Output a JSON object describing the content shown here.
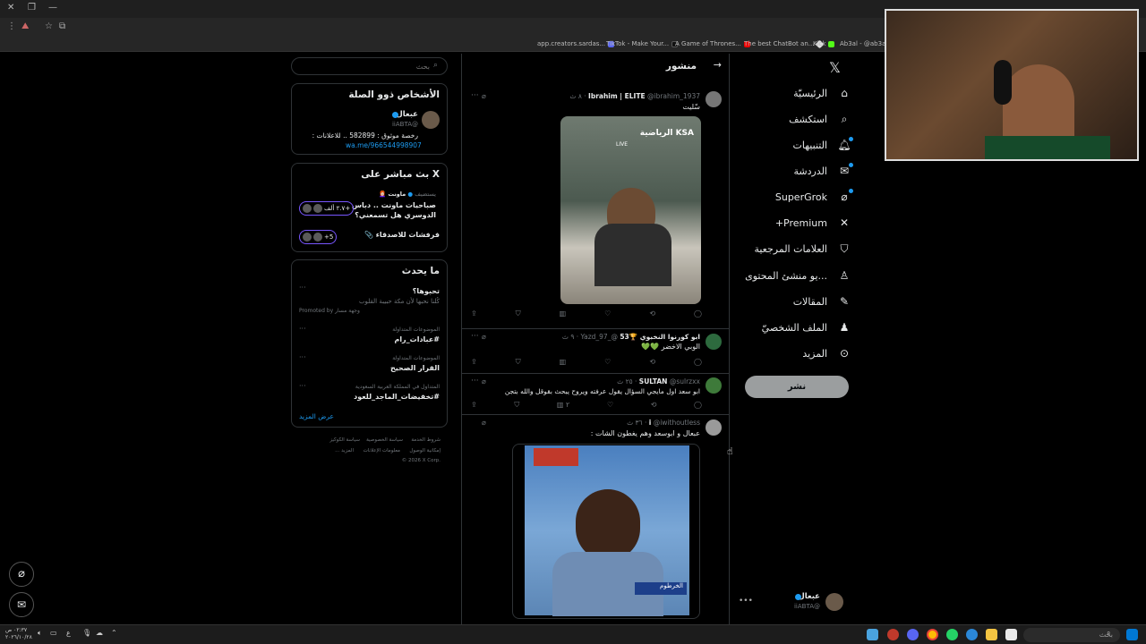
{
  "bookmarks": [
    "app.creators.sardas...",
    "TikTok - Make Your...",
    "A Game of Thrones...",
    "The best ChatBot an...",
    "Kick",
    "Ab3al - @ab3al |"
  ],
  "search": {
    "placeholder": "بحث"
  },
  "nav": {
    "items": [
      {
        "label": "الرئيسيّة",
        "icon": "home-icon"
      },
      {
        "label": "استكشف",
        "icon": "search-icon"
      },
      {
        "label": "التنبيهات",
        "icon": "bell-icon"
      },
      {
        "label": "الدردشة",
        "icon": "mail-icon"
      },
      {
        "label": "SuperGrok",
        "icon": "grok-icon"
      },
      {
        "label": "Premium+",
        "icon": "x-logo-icon"
      },
      {
        "label": "العلامات المرجعية",
        "icon": "bookmark-icon"
      },
      {
        "label": "...يو منشئ المحتوى",
        "icon": "creator-icon"
      },
      {
        "label": "المقالات",
        "icon": "article-icon"
      },
      {
        "label": "الملف الشخصيّ",
        "icon": "person-icon"
      },
      {
        "label": "المزيد",
        "icon": "more-circle-icon"
      }
    ],
    "post_label": "نشر",
    "account": {
      "name": "عبعال",
      "handle": "@iiABTA"
    }
  },
  "timeline": {
    "header": "منشور",
    "tweets": [
      {
        "name": "Ibrahim | ELITE",
        "handle": "@ibrahim_1937",
        "time": "٨ ث",
        "text": "سّليت"
      },
      {
        "name": "ابو كورنوا النخبوي 🏆53",
        "handle": "@_Yazd_97",
        "time": "٩ ث",
        "text": "الوبي الاخضر 💚💚"
      },
      {
        "name": "SULTAN",
        "handle": "@sulrzxx",
        "time": "٢٥ ث",
        "text": "ابو سعد اول مايجي السؤال يقول عرفته ويروح يبحث بقوقل والله بتجن",
        "views": "٢"
      },
      {
        "name": "i",
        "handle": "@iwithoutless",
        "time": "٣٦ ث",
        "text": "عبعال و ابوسعد وهم يغطون الشات :"
      }
    ],
    "video1_overlay": "LIVE",
    "video1_brand": "الرياضية KSA",
    "video2_caption": "الخرطوم"
  },
  "sidebar": {
    "relevant": {
      "title": "الأشخاص ذوو الصلة",
      "name": "عبعال",
      "handle": "@iiABTA",
      "bio": "رخصة موثوق : 582899 .. للاعلانات :",
      "link": "wa.me/966544998907"
    },
    "live": {
      "title": "X بث مباشر على",
      "host_label": "يستضيف",
      "host_name": "ماونت",
      "space_title_1": "صباحيات ماونت .. دباس",
      "space_title_2": "الدوسري هل تسمعني؟",
      "listeners": "٢.٧ ألف+",
      "space2_title": "فرفشات للاصدقاء 📎",
      "space2_count": "+5"
    },
    "trends": {
      "title": "ما يحدث",
      "items": [
        {
          "context": "",
          "title": "تحبوها؟",
          "sub": "كُلنا نحبها لأن مكة حبيبة القلوب",
          "promo": "Promoted by وجهة مسار"
        },
        {
          "context": "الموضوعات المتداولة",
          "title": "#عبادات_رام"
        },
        {
          "context": "الموضوعات المتداولة",
          "title": "القرار الصحيح"
        },
        {
          "context": "المتداول في المملكة العربية السعودية",
          "title": "#تخفيضات_الماجد_للعود"
        }
      ],
      "more": "عرض المزيد"
    },
    "footer": [
      "شروط الخدمة",
      "سياسة الخصوصية",
      "سياسة الكوكيز",
      "إمكانية الوصول",
      "معلومات الإعلانات",
      "المزيد ...",
      "© 2026 X Corp."
    ]
  },
  "taskbar": {
    "search": "بحث",
    "time": "٠٢:٣٧ ص",
    "date": "٢٠٢٦/١٠/٢٨"
  }
}
